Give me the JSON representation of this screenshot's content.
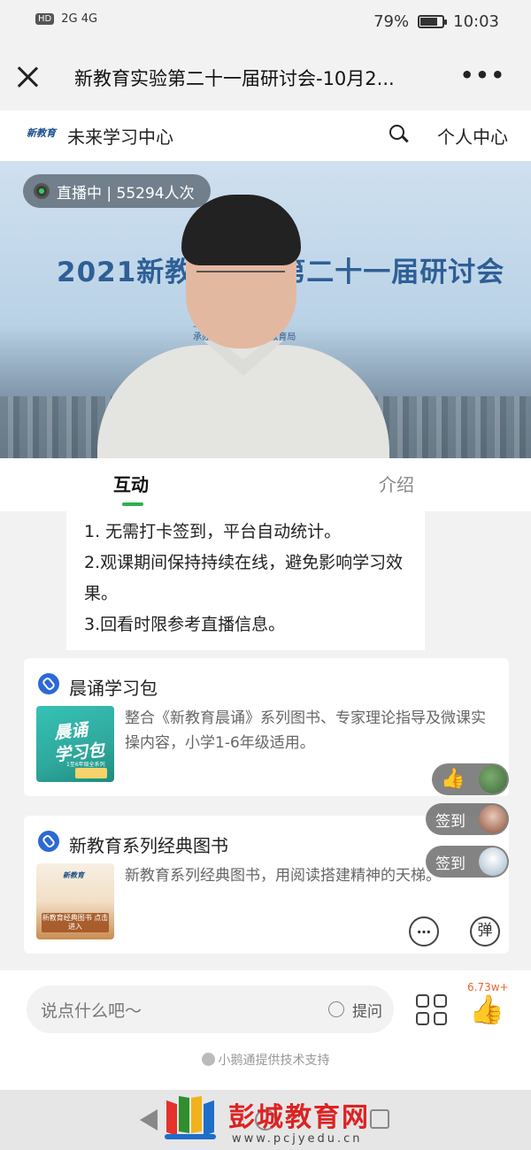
{
  "status_bar": {
    "hd": "HD",
    "signal": "2G 4G",
    "battery": "79%",
    "battery_level": 0.79,
    "time": "10:03"
  },
  "title_bar": {
    "title": "新教育实验第二十一届研讨会-10月2...",
    "close_icon": "close-icon",
    "more_icon": "more-icon"
  },
  "app_bar": {
    "logo": "新教育",
    "name": "未来学习中心",
    "search_icon": "search-icon",
    "user_center": "个人中心"
  },
  "video": {
    "live_badge": "直播中 | 55294人次",
    "banner": "2021新教育实验第二十一届研讨会"
  },
  "tabs": [
    {
      "label": "互动",
      "active": true
    },
    {
      "label": "介绍",
      "active": false
    }
  ],
  "notice": {
    "lines": [
      "1. 无需打卡签到，平台自动统计。",
      "2.观课期间保持持续在线，避免影响学习效果。",
      "3.回看时限参考直播信息。"
    ]
  },
  "cards": [
    {
      "title": "晨诵学习包",
      "desc": "整合《新教育晨诵》系列图书、专家理论指导及微课实操内容，小学1-6年级适用。",
      "thumb_line1": "晨诵",
      "thumb_line2": "学习包",
      "thumb_caption": "1至6年级全系列"
    },
    {
      "title": "新教育系列经典图书",
      "desc": "新教育系列经典图书，用阅读搭建精神的天梯。",
      "thumb_logo": "新教育",
      "thumb_button": "新教育经典图书 点击进入"
    }
  ],
  "floating": {
    "like_icon": "thumbs-up-icon",
    "sign_label_1": "签到",
    "sign_label_2": "签到"
  },
  "buttons": {
    "comment_icon": "…",
    "danmu": "弹"
  },
  "bottom": {
    "input_placeholder": "说点什么吧～",
    "ask_label": "提问",
    "like_count": "6.73w+",
    "powered_by": "小鹅通提供技术支持"
  },
  "watermark": {
    "title": "彭城教育网",
    "url": "www.pcjyedu.cn"
  },
  "colors": {
    "accent_green": "#2bb34a",
    "link_blue": "#2d69d5",
    "like_orange": "#f07a3c"
  }
}
